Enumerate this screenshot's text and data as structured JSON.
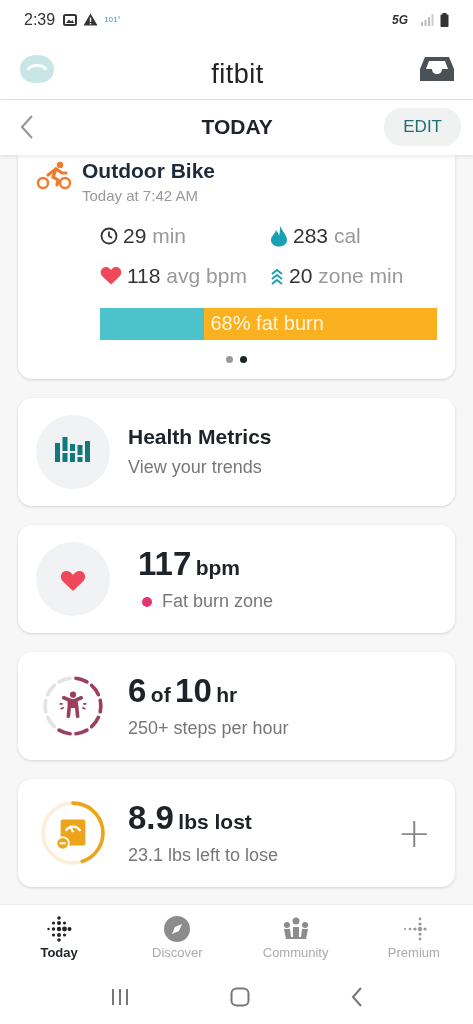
{
  "status_bar": {
    "time": "2:39",
    "temperature": "101°",
    "network": "5G"
  },
  "header": {
    "title": "fitbit"
  },
  "subheader": {
    "title": "TODAY",
    "edit_button": "EDIT"
  },
  "exercise": {
    "name": "Outdoor Bike",
    "time": "Today at 7:42 AM",
    "stats": [
      {
        "kind": "clock",
        "value": "29",
        "unit": "min"
      },
      {
        "kind": "drop",
        "value": "283",
        "unit": "cal"
      },
      {
        "kind": "heart",
        "value": "118",
        "unit": "avg bpm"
      },
      {
        "kind": "zone",
        "value": "20",
        "unit": "zone min"
      }
    ],
    "zone_bar": {
      "label": "68% fat burn",
      "level": 0.69
    },
    "pages": [
      {
        "selected": false
      },
      {
        "selected": true
      }
    ]
  },
  "tiles": [
    {
      "kind": "metrics",
      "title": "Health Metrics",
      "subtitle": "View your trends"
    },
    {
      "kind": "heart",
      "value": "117",
      "unit": "bpm",
      "subtitle": "Fat burn zone",
      "color": "#e8336e"
    },
    {
      "kind": "hourly",
      "value": "6",
      "of": "of",
      "goal": "10",
      "unit": "hr",
      "subtitle": "250+ steps per hour"
    },
    {
      "kind": "weight",
      "value": "8.9",
      "unit": "lbs lost",
      "subtitle": "23.1 lbs left to lose",
      "add": "+"
    }
  ],
  "bottom_nav": [
    {
      "label": "Today",
      "selected": true
    },
    {
      "label": "Discover",
      "selected": false
    },
    {
      "label": "Community",
      "selected": false
    },
    {
      "label": "Premium",
      "selected": false
    }
  ]
}
